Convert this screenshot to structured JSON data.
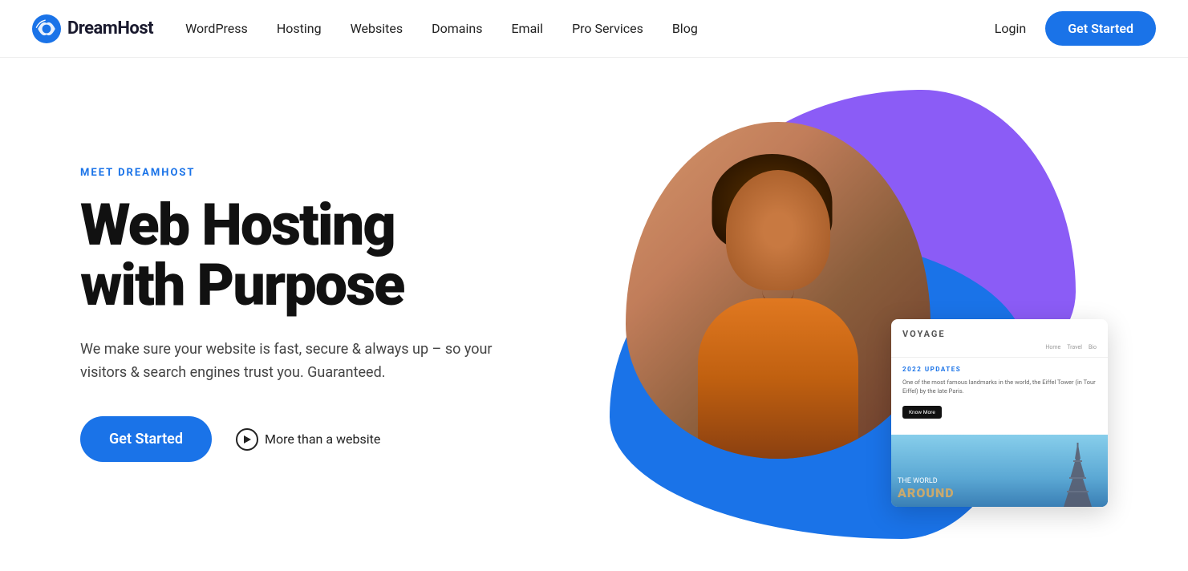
{
  "brand": {
    "name": "DreamHost",
    "logo_alt": "DreamHost logo"
  },
  "nav": {
    "links": [
      {
        "label": "WordPress",
        "id": "wordpress"
      },
      {
        "label": "Hosting",
        "id": "hosting"
      },
      {
        "label": "Websites",
        "id": "websites"
      },
      {
        "label": "Domains",
        "id": "domains"
      },
      {
        "label": "Email",
        "id": "email"
      },
      {
        "label": "Pro Services",
        "id": "pro-services"
      },
      {
        "label": "Blog",
        "id": "blog"
      }
    ],
    "login_label": "Login",
    "cta_label": "Get Started"
  },
  "hero": {
    "meet_label": "MEET DREAMHOST",
    "title_line1": "Web Hosting",
    "title_line2": "with Purpose",
    "subtitle": "We make sure your website is fast, secure & always up – so your visitors & search engines trust you. Guaranteed.",
    "cta_label": "Get Started",
    "secondary_link": "More than a website"
  },
  "card": {
    "site_name": "VOYAGE",
    "nav_items": [
      "Home",
      "Travel",
      "Bio"
    ],
    "tag": "2022 UPDATES",
    "description": "One of the most famous landmarks in the world, the Eiffel Tower (in Tour Eiffel) by the late Paris.",
    "know_more": "Know More",
    "the": "THE WORLD",
    "around": "AROUND"
  },
  "colors": {
    "blue": "#1a73e8",
    "purple": "#8b5cf6",
    "dark": "#111111",
    "text_gray": "#444444"
  }
}
